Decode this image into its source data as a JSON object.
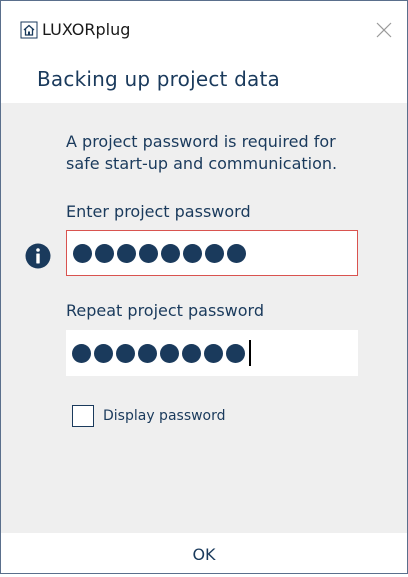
{
  "window": {
    "app_name": "LUXORplug",
    "close_icon": "close-icon",
    "app_icon": "house-icon"
  },
  "header": {
    "title": "Backing up project data"
  },
  "content": {
    "description": "A project password is required for safe start-up and communication.",
    "enter_label": "Enter project password",
    "enter_dot_count": 8,
    "enter_state": "invalid",
    "repeat_label": "Repeat project password",
    "repeat_dot_count": 8,
    "info_icon": "info-icon",
    "display_password_label": "Display password",
    "display_password_checked": false
  },
  "footer": {
    "ok_label": "OK"
  },
  "colors": {
    "text": "#1a3a5c",
    "content_bg": "#efefef",
    "error_border": "#d9534f",
    "window_border": "#5a6f8c"
  }
}
